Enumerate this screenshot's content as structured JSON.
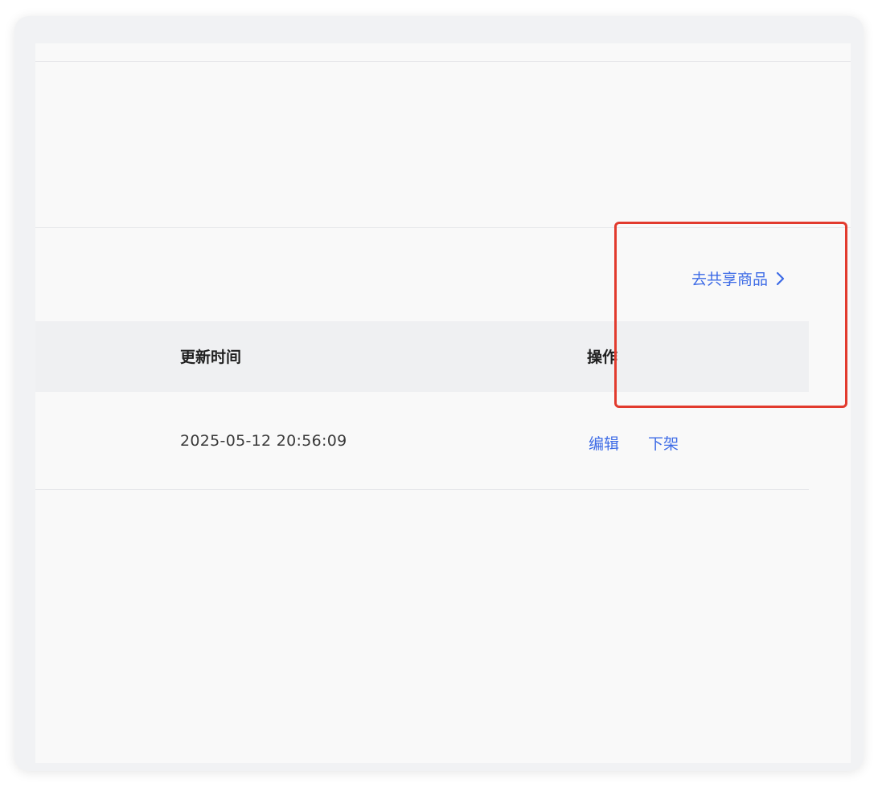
{
  "share_link": {
    "label": "去共享商品",
    "icon": "chevron-right-icon",
    "color": "#3d6be6"
  },
  "table": {
    "columns": [
      "更新时间",
      "操作"
    ],
    "rows": [
      {
        "updated_at": "2025-05-12 20:56:09",
        "actions": [
          "编辑",
          "下架"
        ]
      }
    ]
  },
  "annotation": {
    "color": "#e23b2e"
  }
}
